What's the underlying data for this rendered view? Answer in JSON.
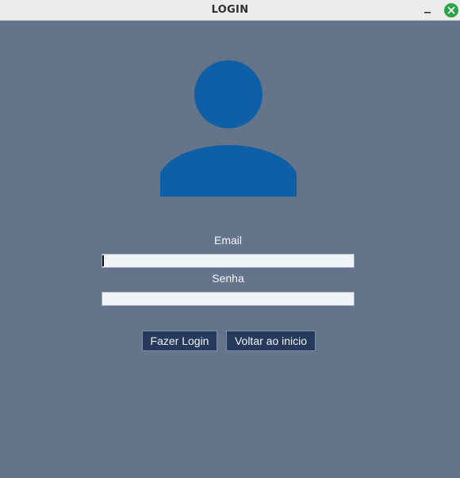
{
  "window": {
    "title": "LOGIN",
    "background_color": "#64758b",
    "titlebar_buttons": [
      {
        "name": "minimize",
        "icon": "minimize-icon"
      },
      {
        "name": "close",
        "icon": "close-icon",
        "color": "#2aa44a"
      }
    ]
  },
  "avatar": {
    "icon": "user-icon",
    "color": "#0e5fa5"
  },
  "form": {
    "email_label": "Email",
    "email_value": "",
    "email_placeholder": "",
    "senha_label": "Senha",
    "senha_value": "",
    "senha_placeholder": ""
  },
  "buttons": {
    "login_label": "Fazer Login",
    "back_label": "Voltar ao inicio",
    "button_color": "#263a5c"
  }
}
